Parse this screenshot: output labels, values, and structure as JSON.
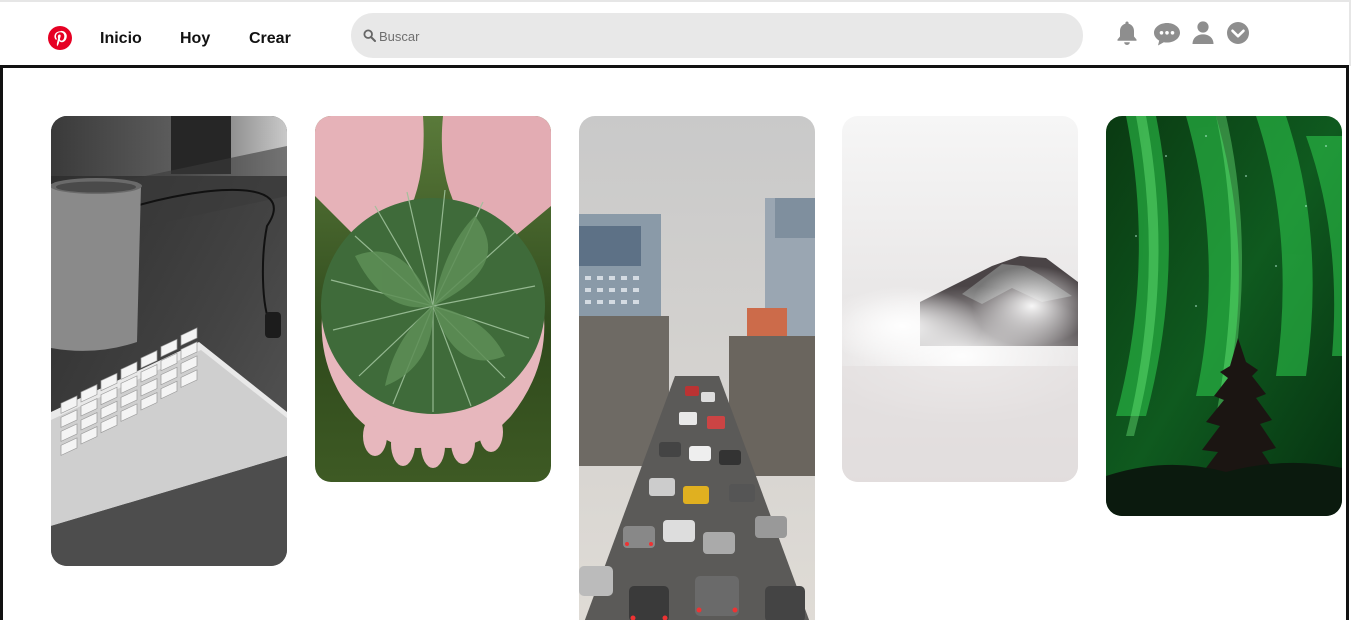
{
  "header": {
    "logo_icon": "pinterest-logo-icon",
    "brand_color": "#e60023",
    "nav": {
      "home_label": "Inicio",
      "today_label": "Hoy",
      "create_label": "Crear"
    },
    "search": {
      "placeholder": "Buscar",
      "icon": "search-icon"
    },
    "icons": [
      "bell-icon",
      "chat-icon",
      "user-icon",
      "chevron-down-icon"
    ]
  },
  "pins": [
    {
      "subject": "keyboard-and-cup-photo"
    },
    {
      "subject": "pine-needles-in-hands-photo"
    },
    {
      "subject": "city-traffic-photo"
    },
    {
      "subject": "misty-mountain-photo"
    },
    {
      "subject": "green-aurora-photo"
    }
  ]
}
